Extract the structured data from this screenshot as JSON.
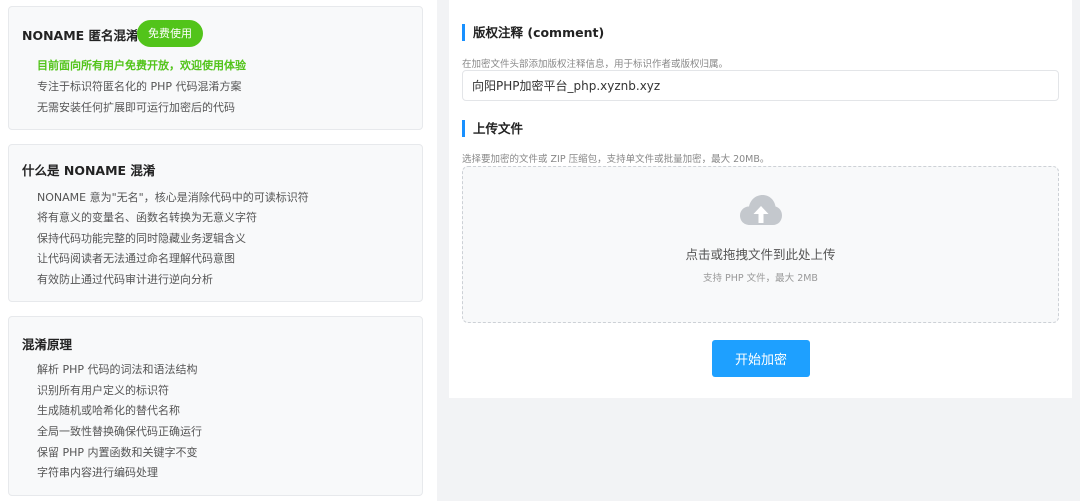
{
  "sidebar": {
    "intro": {
      "title": "NONAME 匿名混淆",
      "badge": "免费使用",
      "highlight": "目前面向所有用户免费开放，欢迎使用体验",
      "items": [
        "专注于标识符匿名化的 PHP 代码混淆方案",
        "无需安装任何扩展即可运行加密后的代码"
      ]
    },
    "what": {
      "title": "什么是 NONAME 混淆",
      "items": [
        "NONAME 意为\"无名\"，核心是消除代码中的可读标识符",
        "将有意义的变量名、函数名转换为无意义字符",
        "保持代码功能完整的同时隐藏业务逻辑含义",
        "让代码阅读者无法通过命名理解代码意图",
        "有效防止通过代码审计进行逆向分析"
      ]
    },
    "principle": {
      "title": "混淆原理",
      "items": [
        "解析 PHP 代码的词法和语法结构",
        "识别所有用户定义的标识符",
        "生成随机或哈希化的替代名称",
        "全局一致性替换确保代码正确运行",
        "保留 PHP 内置函数和关键字不变",
        "字符串内容进行编码处理"
      ]
    }
  },
  "main": {
    "comment": {
      "title": "版权注释 (comment)",
      "hint": "在加密文件头部添加版权注释信息，用于标识作者或版权归属。",
      "value": "向阳PHP加密平台_php.xyznb.xyz"
    },
    "upload": {
      "title": "上传文件",
      "hint": "选择要加密的文件或 ZIP 压缩包，支持单文件或批量加密，最大 20MB。",
      "drop_text": "点击或拖拽文件到此处上传",
      "drop_sub": "支持 PHP 文件，最大 2MB",
      "icon": "cloud-upload-icon"
    },
    "submit_label": "开始加密"
  },
  "colors": {
    "accent": "#1ea0ff",
    "section_bar": "#1890ff",
    "green": "#52c41a"
  }
}
